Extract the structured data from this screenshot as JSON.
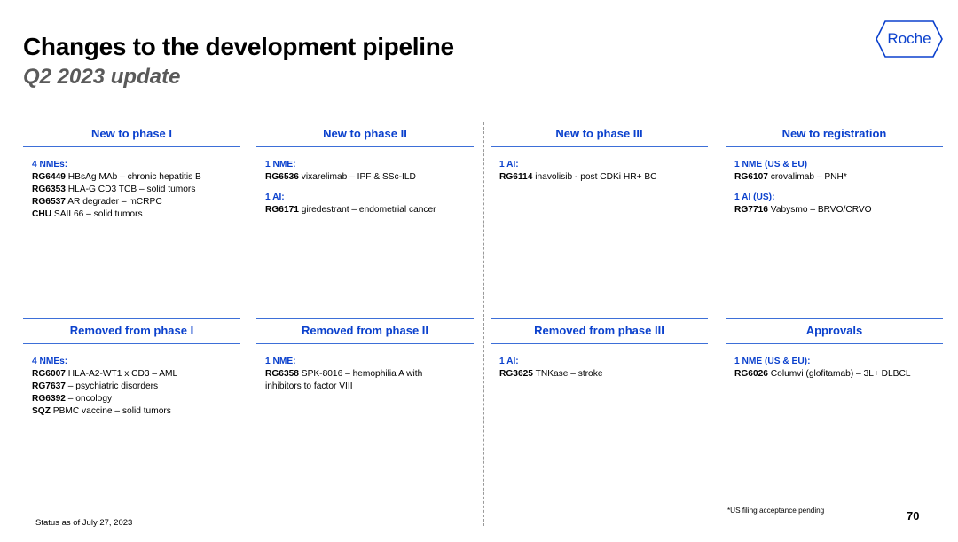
{
  "header": {
    "title": "Changes to the development pipeline",
    "subtitle": "Q2 2023 update",
    "logo_text": "Roche"
  },
  "colors": {
    "accent": "#0b41cd",
    "rule": "#3d6fd8"
  },
  "sections": [
    {
      "title": "New to phase I",
      "groups": [
        {
          "label": "4 NMEs:",
          "items": [
            {
              "code": "RG6449",
              "text": "HBsAg MAb – chronic hepatitis B"
            },
            {
              "code": "RG6353",
              "text": "HLA-G CD3 TCB – solid tumors"
            },
            {
              "code": "RG6537",
              "text": "AR degrader – mCRPC"
            },
            {
              "code": "CHU",
              "text": "SAIL66 – solid tumors"
            }
          ]
        }
      ]
    },
    {
      "title": "New to phase II",
      "groups": [
        {
          "label": "1 NME:",
          "items": [
            {
              "code": "RG6536",
              "text": "vixarelimab – IPF & SSc-ILD"
            }
          ]
        },
        {
          "label": "1 AI:",
          "items": [
            {
              "code": "RG6171",
              "text": "giredestrant – endometrial cancer"
            }
          ]
        }
      ]
    },
    {
      "title": "New to phase III",
      "groups": [
        {
          "label": "1 AI:",
          "items": [
            {
              "code": "RG6114",
              "text": "inavolisib - post CDKi HR+ BC"
            }
          ]
        }
      ]
    },
    {
      "title": "New to registration",
      "groups": [
        {
          "label": "1 NME (US & EU)",
          "items": [
            {
              "code": "RG6107",
              "text": "crovalimab – PNH*"
            }
          ]
        },
        {
          "label": "1 AI (US):",
          "items": [
            {
              "code": "RG7716",
              "text": "Vabysmo – BRVO/CRVO"
            }
          ]
        }
      ]
    },
    {
      "title": "Removed from phase I",
      "groups": [
        {
          "label": "4 NMEs:",
          "items": [
            {
              "code": "RG6007",
              "text": "HLA-A2-WT1 x CD3 – AML"
            },
            {
              "code": "RG7637",
              "text": " – psychiatric disorders"
            },
            {
              "code": "RG6392",
              "text": " – oncology"
            },
            {
              "code": "SQZ",
              "text": "PBMC vaccine – solid tumors"
            }
          ]
        }
      ]
    },
    {
      "title": "Removed from phase II",
      "groups": [
        {
          "label": "1 NME:",
          "items": [
            {
              "code": "RG6358",
              "text": "SPK-8016 – hemophilia A with",
              "text2": "inhibitors to factor VIII"
            }
          ]
        }
      ]
    },
    {
      "title": "Removed from phase III",
      "groups": [
        {
          "label": "1 AI:",
          "items": [
            {
              "code": "RG3625",
              "text": "TNKase – stroke"
            }
          ]
        }
      ]
    },
    {
      "title": "Approvals",
      "groups": [
        {
          "label": "1 NME (US & EU):",
          "items": [
            {
              "code": "RG6026",
              "text": "Columvi (glofitamab) – 3L+ DLBCL"
            }
          ]
        }
      ]
    }
  ],
  "footer": {
    "status": "Status as of July 27, 2023",
    "footnote": "*US filing acceptance pending",
    "page_number": "70"
  }
}
